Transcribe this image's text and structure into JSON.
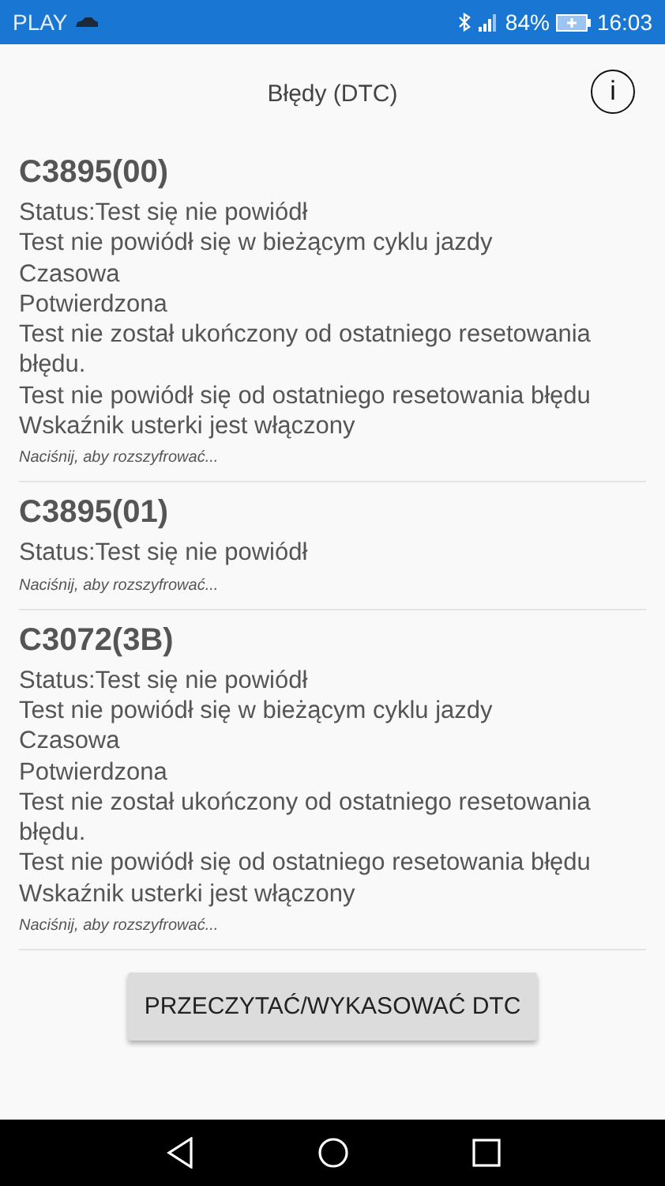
{
  "status_bar": {
    "carrier": "PLAY",
    "battery": "84%",
    "time": "16:03"
  },
  "header": {
    "title": "Błędy (DTC)",
    "info_icon": "i"
  },
  "dtcs": [
    {
      "code": "C3895(00)",
      "lines": [
        "Status:Test się nie powiódł",
        "Test nie powiódł się w bieżącym cyklu jazdy",
        "Czasowa",
        "Potwierdzona",
        "Test nie został ukończony od ostatniego resetowania błędu.",
        "Test nie powiódł się od ostatniego resetowania błędu",
        "Wskaźnik usterki jest włączony"
      ],
      "hint": "Naciśnij, aby rozszyfrować..."
    },
    {
      "code": "C3895(01)",
      "lines": [
        "Status:Test się nie powiódł"
      ],
      "hint": "Naciśnij, aby rozszyfrować..."
    },
    {
      "code": "C3072(3B)",
      "lines": [
        "Status:Test się nie powiódł",
        "Test nie powiódł się w bieżącym cyklu jazdy",
        "Czasowa",
        "Potwierdzona",
        "Test nie został ukończony od ostatniego resetowania błędu.",
        "Test nie powiódł się od ostatniego resetowania błędu",
        "Wskaźnik usterki jest włączony"
      ],
      "hint": "Naciśnij, aby rozszyfrować..."
    }
  ],
  "button": "PRZECZYTAĆ/WYKASOWAĆ DTC"
}
